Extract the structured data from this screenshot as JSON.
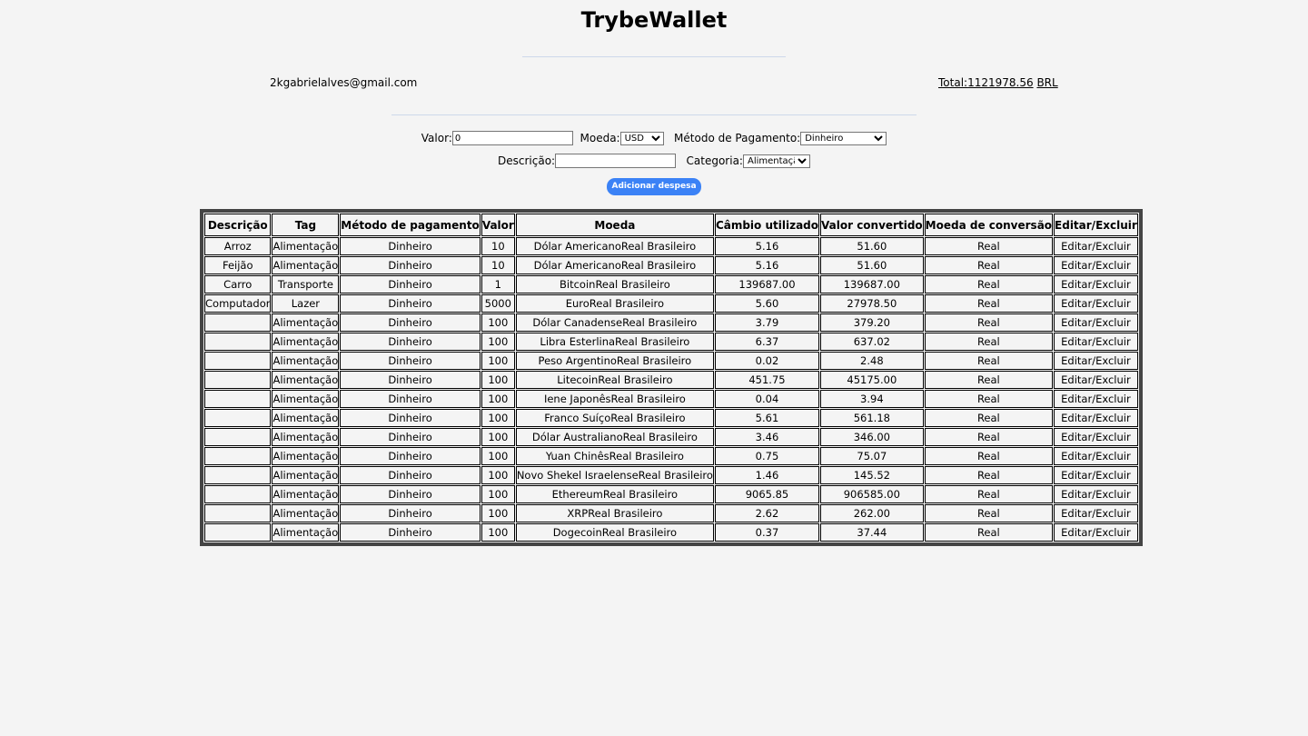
{
  "header": {
    "title": "TrybeWallet",
    "email": "2kgabrielalves@gmail.com",
    "total_label": "Total:",
    "total_value": "1121978.56",
    "currency": "BRL"
  },
  "form": {
    "valor_label": "Valor:",
    "valor_value": "0",
    "moeda_label": "Moeda:",
    "moeda_selected": "USD",
    "metodo_label": "Método de Pagamento:",
    "metodo_selected": "Dinheiro",
    "descricao_label": "Descrição:",
    "descricao_value": "",
    "categoria_label": "Categoria:",
    "categoria_selected": "Alimentação",
    "submit_label": "Adicionar despesa"
  },
  "table": {
    "headers": [
      "Descrição",
      "Tag",
      "Método de pagamento",
      "Valor",
      "Moeda",
      "Câmbio utilizado",
      "Valor convertido",
      "Moeda de conversão",
      "Editar/Excluir"
    ],
    "rows": [
      [
        "Arroz",
        "Alimentação",
        "Dinheiro",
        "10",
        "Dólar AmericanoReal Brasileiro",
        "5.16",
        "51.60",
        "Real",
        "Editar/Excluir"
      ],
      [
        "Feijão",
        "Alimentação",
        "Dinheiro",
        "10",
        "Dólar AmericanoReal Brasileiro",
        "5.16",
        "51.60",
        "Real",
        "Editar/Excluir"
      ],
      [
        "Carro",
        "Transporte",
        "Dinheiro",
        "1",
        "BitcoinReal Brasileiro",
        "139687.00",
        "139687.00",
        "Real",
        "Editar/Excluir"
      ],
      [
        "Computador",
        "Lazer",
        "Dinheiro",
        "5000",
        "EuroReal Brasileiro",
        "5.60",
        "27978.50",
        "Real",
        "Editar/Excluir"
      ],
      [
        "",
        "Alimentação",
        "Dinheiro",
        "100",
        "Dólar CanadenseReal Brasileiro",
        "3.79",
        "379.20",
        "Real",
        "Editar/Excluir"
      ],
      [
        "",
        "Alimentação",
        "Dinheiro",
        "100",
        "Libra EsterlinaReal Brasileiro",
        "6.37",
        "637.02",
        "Real",
        "Editar/Excluir"
      ],
      [
        "",
        "Alimentação",
        "Dinheiro",
        "100",
        "Peso ArgentinoReal Brasileiro",
        "0.02",
        "2.48",
        "Real",
        "Editar/Excluir"
      ],
      [
        "",
        "Alimentação",
        "Dinheiro",
        "100",
        "LitecoinReal Brasileiro",
        "451.75",
        "45175.00",
        "Real",
        "Editar/Excluir"
      ],
      [
        "",
        "Alimentação",
        "Dinheiro",
        "100",
        "Iene JaponêsReal Brasileiro",
        "0.04",
        "3.94",
        "Real",
        "Editar/Excluir"
      ],
      [
        "",
        "Alimentação",
        "Dinheiro",
        "100",
        "Franco SuíçoReal Brasileiro",
        "5.61",
        "561.18",
        "Real",
        "Editar/Excluir"
      ],
      [
        "",
        "Alimentação",
        "Dinheiro",
        "100",
        "Dólar AustralianoReal Brasileiro",
        "3.46",
        "346.00",
        "Real",
        "Editar/Excluir"
      ],
      [
        "",
        "Alimentação",
        "Dinheiro",
        "100",
        "Yuan ChinêsReal Brasileiro",
        "0.75",
        "75.07",
        "Real",
        "Editar/Excluir"
      ],
      [
        "",
        "Alimentação",
        "Dinheiro",
        "100",
        "Novo Shekel IsraelenseReal Brasileiro",
        "1.46",
        "145.52",
        "Real",
        "Editar/Excluir"
      ],
      [
        "",
        "Alimentação",
        "Dinheiro",
        "100",
        "EthereumReal Brasileiro",
        "9065.85",
        "906585.00",
        "Real",
        "Editar/Excluir"
      ],
      [
        "",
        "Alimentação",
        "Dinheiro",
        "100",
        "XRPReal Brasileiro",
        "2.62",
        "262.00",
        "Real",
        "Editar/Excluir"
      ],
      [
        "",
        "Alimentação",
        "Dinheiro",
        "100",
        "DogecoinReal Brasileiro",
        "0.37",
        "37.44",
        "Real",
        "Editar/Excluir"
      ]
    ]
  }
}
